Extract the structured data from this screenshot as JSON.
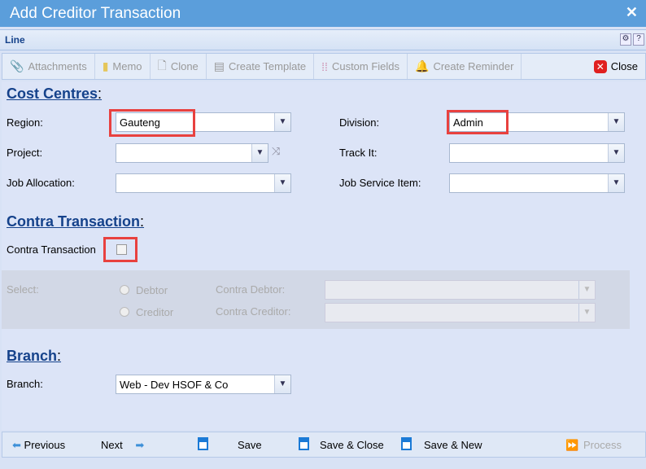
{
  "window": {
    "title": "Add Creditor Transaction",
    "close": "✕"
  },
  "linebar": {
    "label": "Line"
  },
  "toolbar": [
    "Attachments",
    "Memo",
    "Clone",
    "Create Template",
    "Custom Fields",
    "Create Reminder"
  ],
  "toolbar_close": "Close",
  "cost_centres": {
    "heading": "Cost Centres",
    "region_label": "Region:",
    "region": "Gauteng",
    "division_label": "Division:",
    "division": "Admin",
    "project_label": "Project:",
    "trackit_label": "Track It:",
    "job_alloc_label": "Job Allocation:",
    "job_service_label": "Job Service Item:"
  },
  "contra": {
    "heading": "Contra Transaction",
    "checkbox_label": "Contra Transaction",
    "select_label": "Select:",
    "debtor": "Debtor",
    "creditor": "Creditor",
    "contra_debtor_label": "Contra Debtor:",
    "contra_creditor_label": "Contra Creditor:"
  },
  "branch": {
    "heading": "Branch",
    "label": "Branch:",
    "value": "Web - Dev HSOF & Co"
  },
  "footer": {
    "previous": "Previous",
    "next": "Next",
    "save": "Save",
    "save_close": "Save & Close",
    "save_new": "Save & New",
    "process": "Process"
  }
}
